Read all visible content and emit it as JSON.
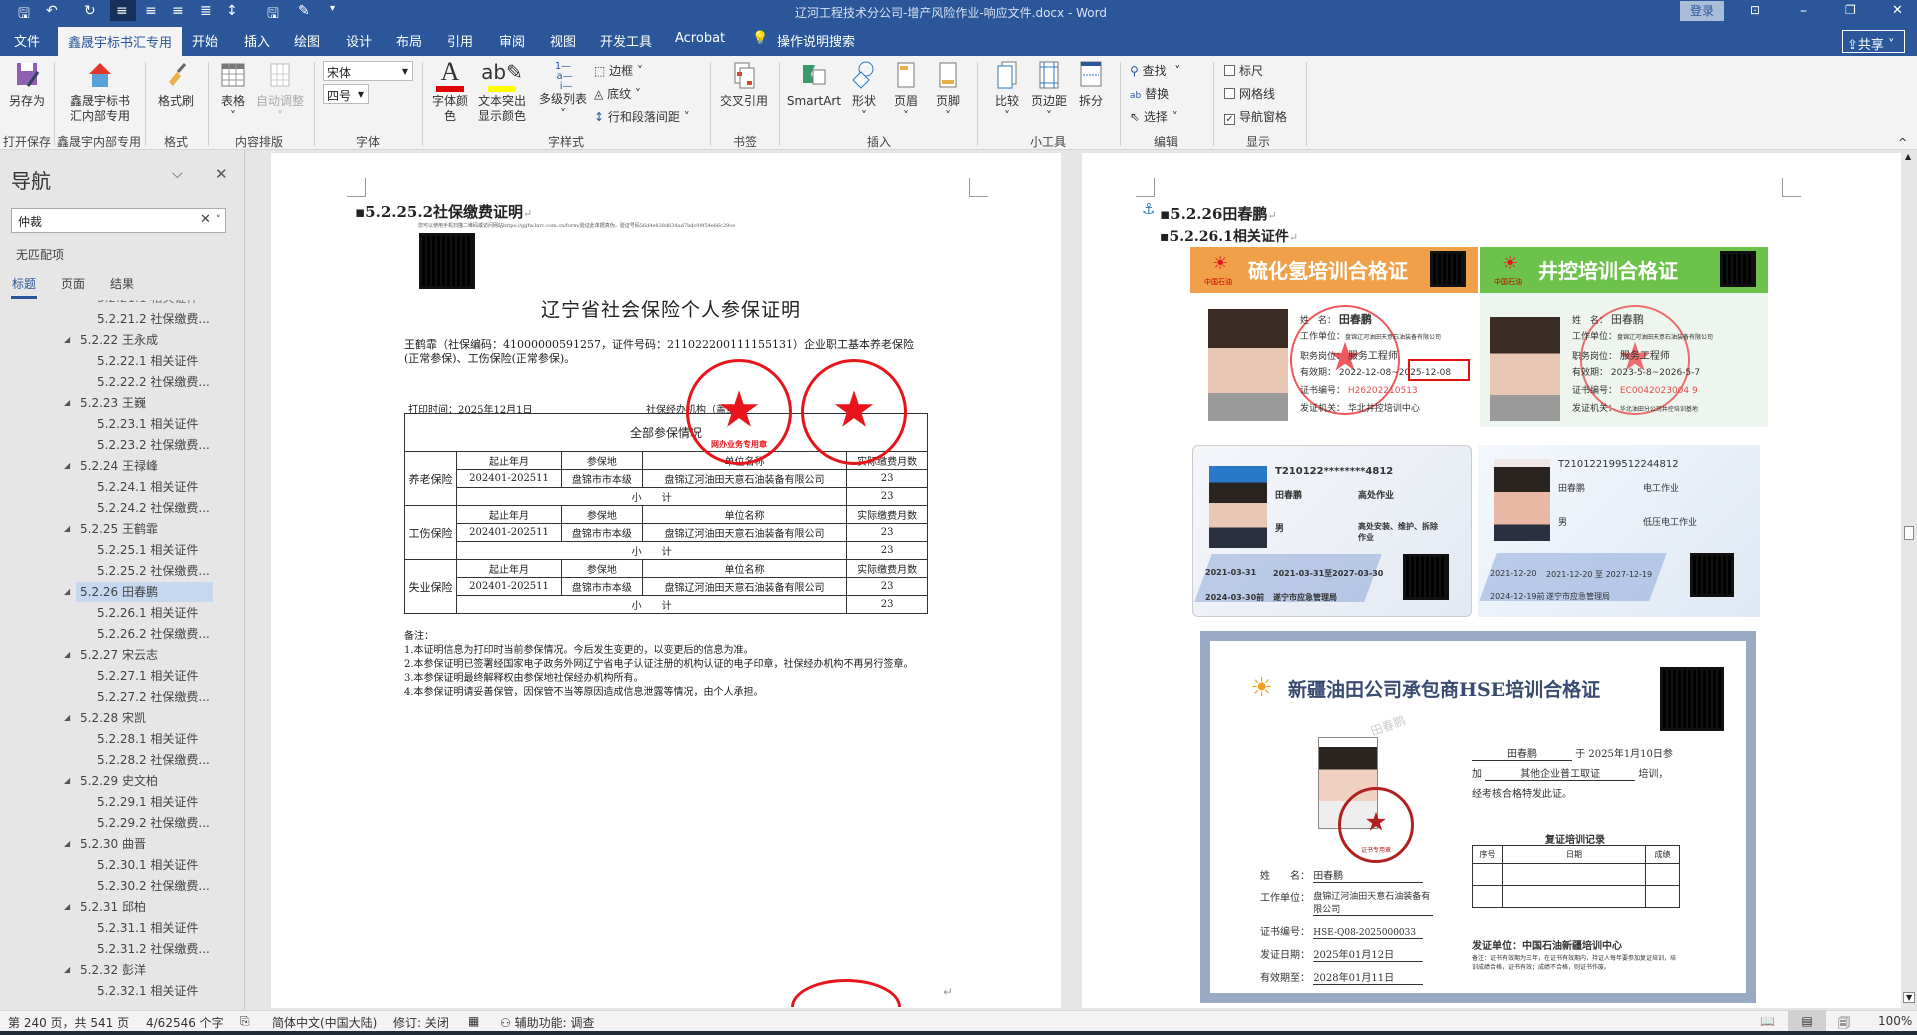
{
  "window": {
    "title": "辽河工程技术分公司-增产风险作业-响应文件.docx  -  Word",
    "login": "登录",
    "share": "共享"
  },
  "tabs": [
    "文件",
    "鑫晟宇标书汇专用",
    "开始",
    "插入",
    "绘图",
    "设计",
    "布局",
    "引用",
    "审阅",
    "视图",
    "开发工具",
    "Acrobat"
  ],
  "tell_me": "操作说明搜索",
  "ribbon": {
    "save_as": "另存为",
    "group_save": "打开保存",
    "xsy": "鑫晟宇标书汇内部专用",
    "group_xsy": "鑫晟宇内部专用",
    "format_painter": "格式刷",
    "group_format": "格式",
    "table": "表格",
    "autofit": "自动调整",
    "group_layout": "内容排版",
    "font_name": "宋体",
    "font_size": "四号",
    "group_font": "字体",
    "font_color": "字体颜色",
    "highlight": "文本突出显示颜色",
    "multilevel": "多级列表",
    "border": "边框",
    "shading": "底纹",
    "spacing": "行和段落间距",
    "group_style": "字样式",
    "crossref": "交叉引用",
    "group_bookmark": "书签",
    "smartart": "SmartArt",
    "shape": "形状",
    "header": "页眉",
    "footer": "页脚",
    "group_insert": "插入",
    "compare": "比较",
    "margins": "页边距",
    "split": "拆分",
    "group_tools": "小工具",
    "find": "查找",
    "replace": "替换",
    "select": "选择",
    "group_edit": "编辑",
    "ruler": "标尺",
    "gridlines": "网格线",
    "navpane": "导航窗格",
    "group_show": "显示",
    "ruler_checked": false,
    "gridlines_checked": false,
    "navpane_checked": true,
    "font_color_hex": "#e00000",
    "highlight_hex": "#ffff00"
  },
  "nav": {
    "title": "导航",
    "search_value": "仲裁",
    "no_match": "无匹配项",
    "tabs": [
      "标题",
      "页面",
      "结果"
    ],
    "items": [
      {
        "label": "5.2.21.2 社保缴费...",
        "level": 3
      },
      {
        "label": "5.2.22 王永成",
        "level": 2
      },
      {
        "label": "5.2.22.1 相关证件",
        "level": 3
      },
      {
        "label": "5.2.22.2 社保缴费...",
        "level": 3
      },
      {
        "label": "5.2.23 王巍",
        "level": 2
      },
      {
        "label": "5.2.23.1 相关证件",
        "level": 3
      },
      {
        "label": "5.2.23.2 社保缴费...",
        "level": 3
      },
      {
        "label": "5.2.24 王禄峰",
        "level": 2
      },
      {
        "label": "5.2.24.1 相关证件",
        "level": 3
      },
      {
        "label": "5.2.24.2 社保缴费...",
        "level": 3
      },
      {
        "label": "5.2.25 王鹤霏",
        "level": 2
      },
      {
        "label": "5.2.25.1 相关证件",
        "level": 3
      },
      {
        "label": "5.2.25.2 社保缴费...",
        "level": 3
      },
      {
        "label": "5.2.26 田春鹏",
        "level": 2,
        "selected": true
      },
      {
        "label": "5.2.26.1 相关证件",
        "level": 3
      },
      {
        "label": "5.2.26.2 社保缴费...",
        "level": 3
      },
      {
        "label": "5.2.27 宋云志",
        "level": 2
      },
      {
        "label": "5.2.27.1 相关证件",
        "level": 3
      },
      {
        "label": "5.2.27.2 社保缴费...",
        "level": 3
      },
      {
        "label": "5.2.28 宋凯",
        "level": 2
      },
      {
        "label": "5.2.28.1 相关证件",
        "level": 3
      },
      {
        "label": "5.2.28.2 社保缴费...",
        "level": 3
      },
      {
        "label": "5.2.29 史文柏",
        "level": 2
      },
      {
        "label": "5.2.29.1 相关证件",
        "level": 3
      },
      {
        "label": "5.2.29.2 社保缴费...",
        "level": 3
      },
      {
        "label": "5.2.30 曲晋",
        "level": 2
      },
      {
        "label": "5.2.30.1 相关证件",
        "level": 3
      },
      {
        "label": "5.2.30.2 社保缴费...",
        "level": 3
      },
      {
        "label": "5.2.31 邱柏",
        "level": 2
      },
      {
        "label": "5.2.31.1 相关证件",
        "level": 3
      },
      {
        "label": "5.2.31.2 社保缴费...",
        "level": 3
      },
      {
        "label": "5.2.32 彭洋",
        "level": 2
      },
      {
        "label": "5.2.32.1 相关证件",
        "level": 3
      }
    ]
  },
  "left_page": {
    "heading": "5.2.25.2社保缴费证明",
    "verify_note": "您可以使用手机扫描二维码或访问网站https://ggfw.lnrc.com.cn/form/验证此单据真伪，验证号码56d4e828d634ad7bdc99f54e66c29ce",
    "cert_title": "辽宁省社会保险个人参保证明",
    "intro": "王鹤霏（社保编码：41000000591257，证件号码：211022200111155131）企业职工基本养老保险(正常参保)、工伤保险(正常参保)。",
    "print_time": "打印时间：2025年12月1日",
    "agency": "社保经办机构（盖章）",
    "table_title": "全部参保情况",
    "col_headers": [
      "起止年月",
      "参保地",
      "单位名称",
      "实际缴费月数"
    ],
    "subtotal_label": "小　　计",
    "sections": [
      {
        "type": "养老保险",
        "period": "202401-202511",
        "place": "盘锦市市本级",
        "unit": "盘锦辽河油田天意石油装备有限公司",
        "months": "23",
        "subtotal": "23"
      },
      {
        "type": "工伤保险",
        "period": "202401-202511",
        "place": "盘锦市市本级",
        "unit": "盘锦辽河油田天意石油装备有限公司",
        "months": "23",
        "subtotal": "23"
      },
      {
        "type": "失业保险",
        "period": "202401-202511",
        "place": "盘锦市市本级",
        "unit": "盘锦辽河油田天意石油装备有限公司",
        "months": "23",
        "subtotal": "23"
      }
    ],
    "stamp_text": "网办业务专用章",
    "notes_title": "备注：",
    "notes": [
      "1.本证明信息为打印时当前参保情况。今后发生变更的，以变更后的信息为准。",
      "2.本参保证明已签署经国家电子政务外网辽宁省电子认证注册的机构认证的电子印章，社保经办机构不再另行签章。",
      "3.本参保证明最终解释权由参保地社保经办机构所有。",
      "4.本参保证明请妥善保管，因保管不当等原因造成信息泄露等情况，由个人承担。"
    ]
  },
  "right_page": {
    "heading1": "5.2.26田春鹏",
    "heading2": "5.2.26.1相关证件",
    "card1": {
      "title": "硫化氢培训合格证",
      "brand": "中国石油",
      "name_label": "姓　名：",
      "name": "田春鹏",
      "unit_label": "工作单位：",
      "unit": "盘锦辽河油田天意石油装备有限公司",
      "post_label": "职务岗位：",
      "post": "服务工程师",
      "valid_label": "有效期：",
      "valid": "2022-12-08~2025-12-08",
      "no_label": "证书编号：",
      "no": "H26202210513",
      "issuer_label": "发证机关：",
      "issuer": "华北井控培训中心"
    },
    "card2": {
      "title": "井控培训合格证",
      "brand": "中国石油",
      "name_label": "姓　名：",
      "name": "田春鹏",
      "unit_label": "工作单位：",
      "unit": "盘锦辽河油田天意石油装备有限公司",
      "post_label": "职务岗位：",
      "post": "服务工程师",
      "valid_label": "有效期：",
      "valid": "2023-5-8~2026-5-7",
      "no_label": "证书编号：",
      "no": "EC0042023004 9",
      "issuer_label": "发证机关：",
      "issuer": "华北油田分公司井控培训基地"
    },
    "card3": {
      "id": "T210122********4812",
      "name": "田春鹏",
      "category": "高处作业",
      "sex": "男",
      "item": "高处安装、维护、拆除作业",
      "first_date": "2021-03-31",
      "valid": "2021-03-31至2027-03-30",
      "review": "2024-03-30前",
      "issuer": "遂宁市应急管理局"
    },
    "card4": {
      "id": "T210122199512244812",
      "name": "田春鹏",
      "category": "电工作业",
      "sex": "男",
      "item": "低压电工作业",
      "first_date": "2021-12-20",
      "valid": "2021-12-20 至 2027-12-19",
      "review": "2024-12-19前",
      "issuer": "遂宁市应急管理局"
    },
    "hse": {
      "title": "新疆油田公司承包商HSE培训合格证",
      "line1_name": "田春鹏",
      "line1_rest": "于 2025年1月10日参",
      "line2_pre": "加",
      "line2_course": "其他企业普工取证",
      "line2_post": "培训，",
      "line3": "经考核合格特发此证。",
      "name_label": "姓　　名：",
      "name": "田春鹏",
      "unit_label": "工作单位：",
      "unit": "盘锦辽河油田天意石油装备有限公司",
      "no_label": "证书编号：",
      "no": "HSE-Q08-2025000033",
      "issue_label": "发证日期：",
      "issue": "2025年01月12日",
      "expire_label": "有效期至：",
      "expire": "2028年01月11日",
      "record_title": "复证培训记录",
      "record_cols": [
        "序号",
        "日期",
        "成绩"
      ],
      "issuer": "发证单位：中国石油新疆培训中心",
      "remark": "备注：证书有效期为三年，在证书有效期内，持证人每年要参加复证培训，培训成绩合格，证书有效；成绩不合格，则证书作废。",
      "stamp_text": "证书专用章",
      "watermark": "田春鹏"
    }
  },
  "status": {
    "page": "第 240 页，共 541 页",
    "words": "4/62546 个字",
    "lang": "简体中文(中国大陆)",
    "track": "修订: 关闭",
    "access": "辅助功能: 调查",
    "zoom": "100%"
  }
}
